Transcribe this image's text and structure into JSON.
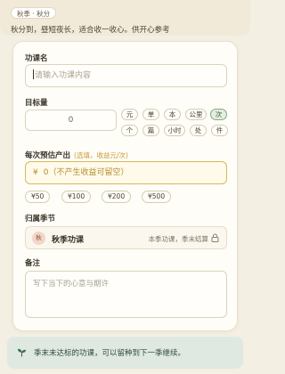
{
  "banner": {
    "chip": "秋季 · 秋分",
    "description": "秋分到，昼短夜长，适合收一收心。供开心参考"
  },
  "form": {
    "name": {
      "label": "功课名",
      "placeholder": "请输入功课内容"
    },
    "target": {
      "label": "目标量",
      "value": "0",
      "units_row1": [
        "元",
        "单",
        "本",
        "公里",
        "次"
      ],
      "units_row2": [
        "个",
        "篇",
        "小时",
        "处",
        "件"
      ],
      "selected_unit": "次"
    },
    "yield": {
      "label": "每次预估产出",
      "hint": "(选填，收益元/次)",
      "symbol": "¥",
      "placeholder": "0（不产生收益可留空）",
      "presets": [
        "¥50",
        "¥100",
        "¥200",
        "¥500"
      ]
    },
    "season": {
      "label": "归属季节",
      "badge": "秋",
      "name": "秋季功课",
      "note": "本季功课，季末结算"
    },
    "note": {
      "label": "备注",
      "placeholder": "写下当下的心意与期许"
    }
  },
  "tip": {
    "text": "季末未达标的功课，可以留种到下一季继续。"
  },
  "colors": {
    "background": "#f4efe3",
    "accent_gold": "#d8b95a",
    "selected_green": "#8aa888",
    "tip_bg": "#dfe9e2"
  },
  "icons": {
    "lock": "lock-icon",
    "sprout": "sprout-icon"
  }
}
